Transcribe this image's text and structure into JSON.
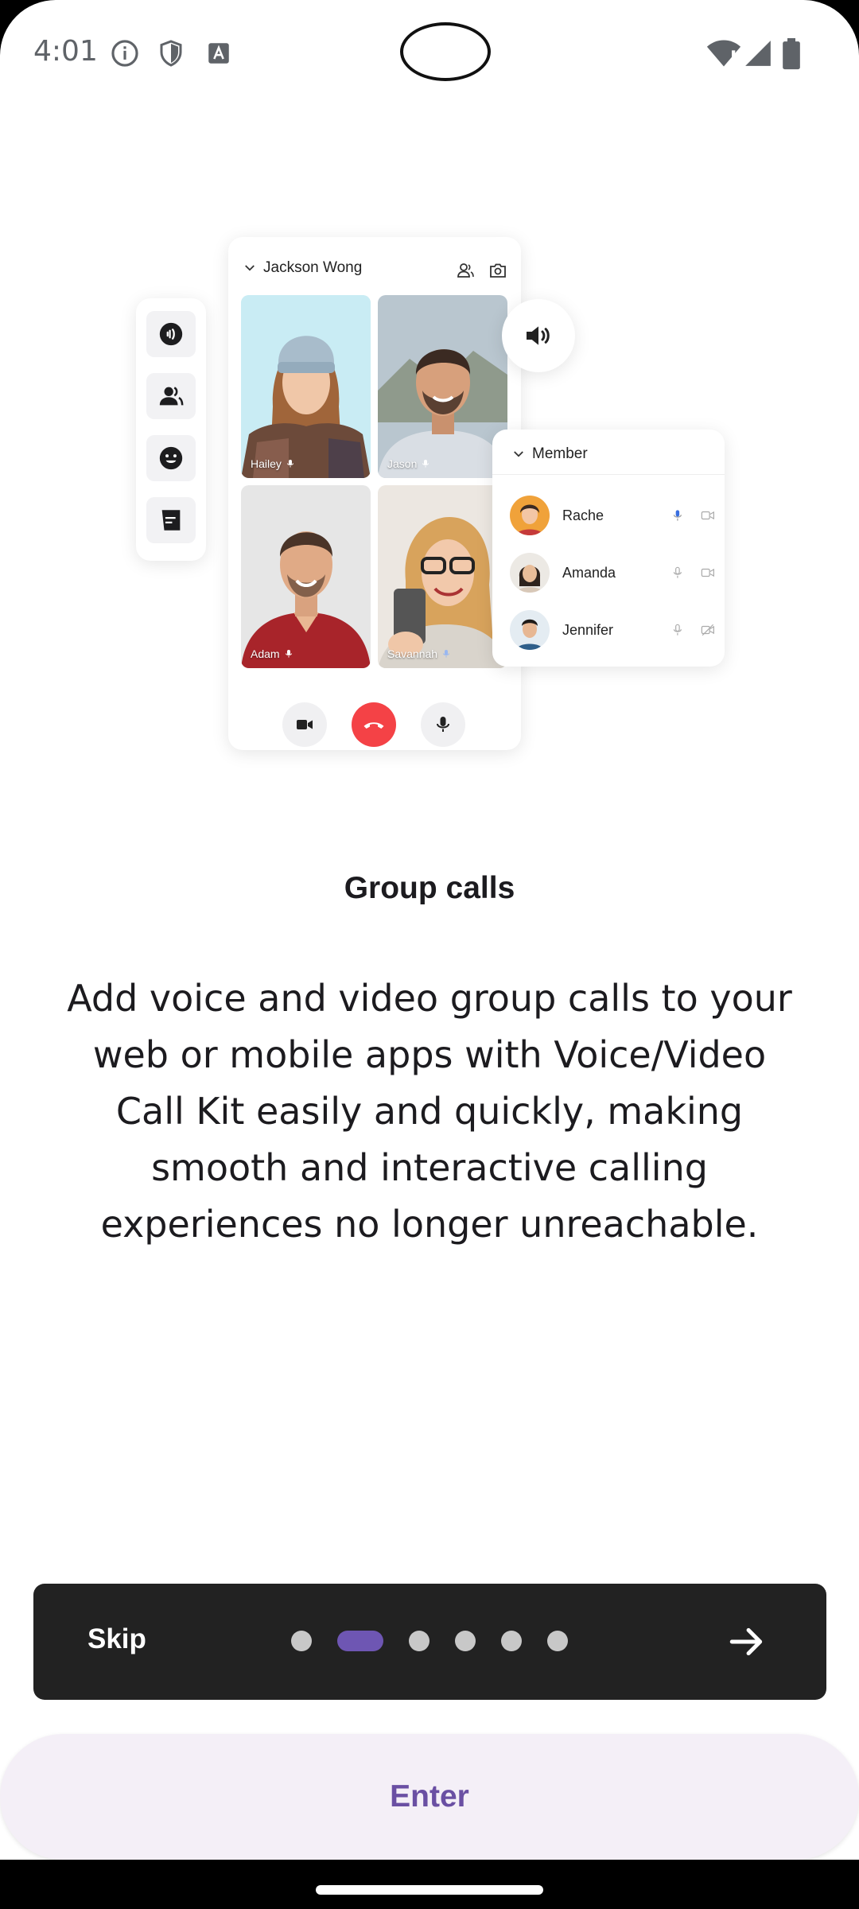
{
  "status_bar": {
    "time": "4:01",
    "icons": [
      "info-icon",
      "shield-icon",
      "a-font-icon",
      "wifi-icon",
      "signal-icon",
      "battery-icon"
    ]
  },
  "illustration": {
    "call_header": "Jackson Wong",
    "tiles": [
      {
        "name": "Hailey"
      },
      {
        "name": "Jason"
      },
      {
        "name": "Adam"
      },
      {
        "name": "Savannah"
      }
    ],
    "member_panel": {
      "title": "Member",
      "members": [
        {
          "name": "Rache"
        },
        {
          "name": "Amanda"
        },
        {
          "name": "Jennifer"
        }
      ]
    }
  },
  "content": {
    "title": "Group calls",
    "description": "Add voice and video group calls to your web or mobile apps with Voice/Video Call Kit easily and quickly, making smooth and interactive calling experiences no longer unreachable."
  },
  "pager": {
    "skip_label": "Skip",
    "page_count": 6,
    "active_index": 1,
    "next_icon": "arrow-right-icon"
  },
  "enter_label": "Enter",
  "colors": {
    "accent": "#6e56b3",
    "pager_bg": "#222222",
    "enter_bg": "#f4eff7",
    "end_call": "#f44246"
  }
}
